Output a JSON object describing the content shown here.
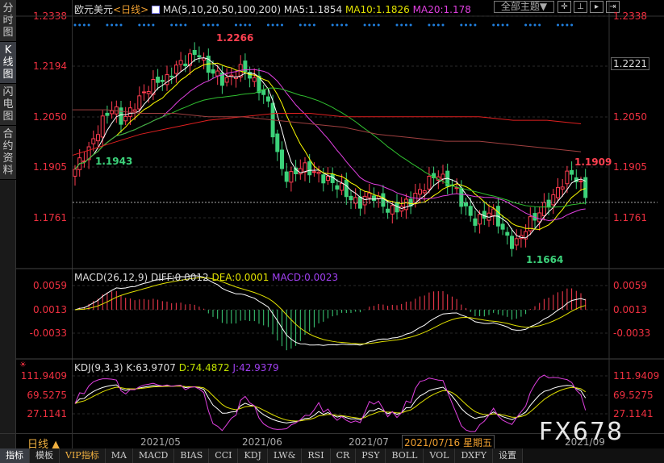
{
  "sidebar": {
    "items": [
      {
        "label": "分时图"
      },
      {
        "label": "K线图",
        "active": true
      },
      {
        "label": "闪电图"
      },
      {
        "label": "合约资料"
      }
    ]
  },
  "header": {
    "symbol": "欧元美元",
    "period_prefix": "<",
    "period": "日线",
    "period_suffix": ">",
    "ma_params": "MA(5,10,20,50,100,200)",
    "ma5": "MA5:1.1854",
    "ma10": "MA10:1.1826",
    "ma20": "MA20:1.178",
    "theme_button": "全部主题▼"
  },
  "price_axis": {
    "labels": [
      "1.2338",
      "1.2194",
      "1.2050",
      "1.1905",
      "1.1761"
    ],
    "current": "1.2221"
  },
  "annotations": {
    "high": "1.2266",
    "low1": "1.1943",
    "high2": "1.1909",
    "low2": "1.1664"
  },
  "macd": {
    "title": "MACD(26,12,9)",
    "diff": "DIFF:0.0012",
    "dea": "DEA:0.0001",
    "macd": "MACD:0.0023",
    "labels": [
      "0.0059",
      "0.0013",
      "-0.0033"
    ]
  },
  "kdj": {
    "title": "KDJ(9,3,3)",
    "k": "K:63.9707",
    "d": "D:74.4872",
    "j": "J:42.9379",
    "labels": [
      "111.9409",
      "69.5275",
      "27.1141"
    ]
  },
  "time_axis": {
    "period": "日线",
    "labels": [
      "2021/05",
      "2021/06",
      "2021/07",
      "2021/09"
    ],
    "cursor": "2021/07/16 星期五"
  },
  "tabs": [
    "指标",
    "模板",
    "VIP指标",
    "MA",
    "MACD",
    "BIAS",
    "CCI",
    "KDJ",
    "LW&",
    "RSI",
    "CR",
    "PSY",
    "BOLL",
    "VOL",
    "DXFY",
    "设置"
  ],
  "watermark": "FX678",
  "colors": {
    "up": "#ff3c50",
    "down": "#3cd27a",
    "ma5": "#ffffff",
    "ma10": "#ffff00",
    "ma20": "#e040e0",
    "ma50": "#30c030",
    "ma100": "#e02020",
    "ma200": "#a04040"
  },
  "chart_data": {
    "type": "candlestick",
    "ylim": [
      1.1664,
      1.2338
    ],
    "closes": [
      1.19,
      1.193,
      1.195,
      1.199,
      1.203,
      1.206,
      1.208,
      1.204,
      1.205,
      1.208,
      1.21,
      1.213,
      1.214,
      1.216,
      1.215,
      1.218,
      1.22,
      1.221,
      1.222,
      1.224,
      1.22,
      1.218,
      1.217,
      1.215,
      1.216,
      1.218,
      1.219,
      1.217,
      1.214,
      1.212,
      1.208,
      1.196,
      1.19,
      1.187,
      1.189,
      1.191,
      1.19,
      1.189,
      1.188,
      1.187,
      1.186,
      1.185,
      1.183,
      1.181,
      1.18,
      1.182,
      1.183,
      1.181,
      1.179,
      1.178,
      1.179,
      1.18,
      1.181,
      1.183,
      1.185,
      1.187,
      1.189,
      1.187,
      1.186,
      1.184,
      1.18,
      1.177,
      1.175,
      1.176,
      1.178,
      1.177,
      1.173,
      1.17,
      1.168,
      1.171,
      1.174,
      1.176,
      1.178,
      1.18,
      1.182,
      1.185,
      1.188,
      1.189,
      1.186,
      1.183
    ],
    "ma100": [
      1.194,
      1.197,
      1.2,
      1.202,
      1.204,
      1.205,
      1.206,
      1.206,
      1.205,
      1.205,
      1.205,
      1.205,
      1.205,
      1.204,
      1.204,
      1.203
    ],
    "ma200": [
      1.207,
      1.207,
      1.206,
      1.206,
      1.205,
      1.205,
      1.204,
      1.203,
      1.202,
      1.2,
      1.199,
      1.198,
      1.198,
      1.197,
      1.196,
      1.195
    ]
  }
}
